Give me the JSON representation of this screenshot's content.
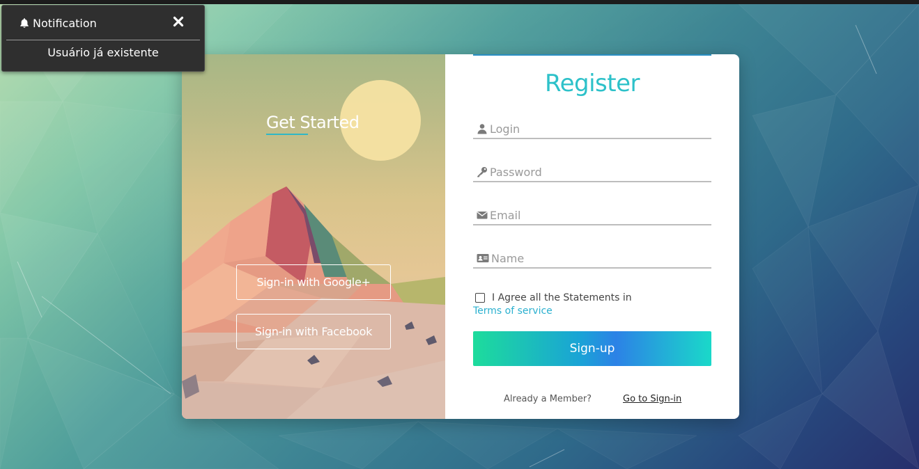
{
  "notification": {
    "title": "Notification",
    "message": "Usuário já existente",
    "icon": "bell-icon",
    "close_icon": "close-icon"
  },
  "hero": {
    "title": "Get Started",
    "google_label": "Sign-in with Google+",
    "facebook_label": "Sign-in with Facebook"
  },
  "register": {
    "title": "Register",
    "fields": [
      {
        "placeholder": "Login",
        "value": "",
        "icon": "user-icon"
      },
      {
        "placeholder": "Password",
        "value": "",
        "icon": "key-icon"
      },
      {
        "placeholder": "Email",
        "value": "",
        "icon": "envelope-icon"
      },
      {
        "placeholder": "Name",
        "value": "",
        "icon": "id-card-icon"
      }
    ],
    "agree_text": "I Agree all the Statements in",
    "terms_link": "Terms of service",
    "signup_label": "Sign-up",
    "already_text": "Already a Member?",
    "goto_signin": "Go to Sign-in"
  },
  "colors": {
    "accent": "#2dc1c9",
    "link": "#2ab0cf",
    "notification_bg": "#2f2f2f"
  }
}
